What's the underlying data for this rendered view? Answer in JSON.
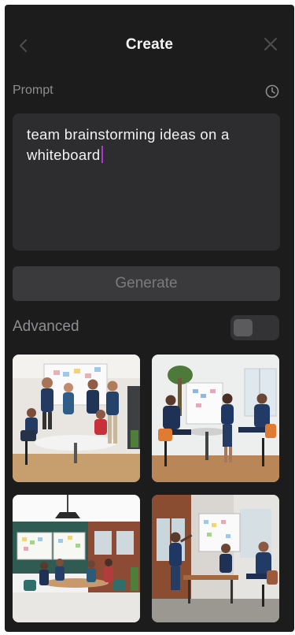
{
  "header": {
    "title": "Create",
    "back_icon": "chevron-left-icon",
    "close_icon": "close-icon"
  },
  "prompt": {
    "label": "Prompt",
    "history_icon": "clock-icon",
    "value": "team brainstorming ideas on a whiteboard"
  },
  "generate": {
    "label": "Generate"
  },
  "advanced": {
    "label": "Advanced",
    "toggle_on": false
  },
  "results": {
    "count": 4
  },
  "colors": {
    "panel_bg": "#1c1c1d",
    "input_bg": "#2d2d2f",
    "button_bg": "#3a3a3c",
    "caret": "#b036d6"
  }
}
